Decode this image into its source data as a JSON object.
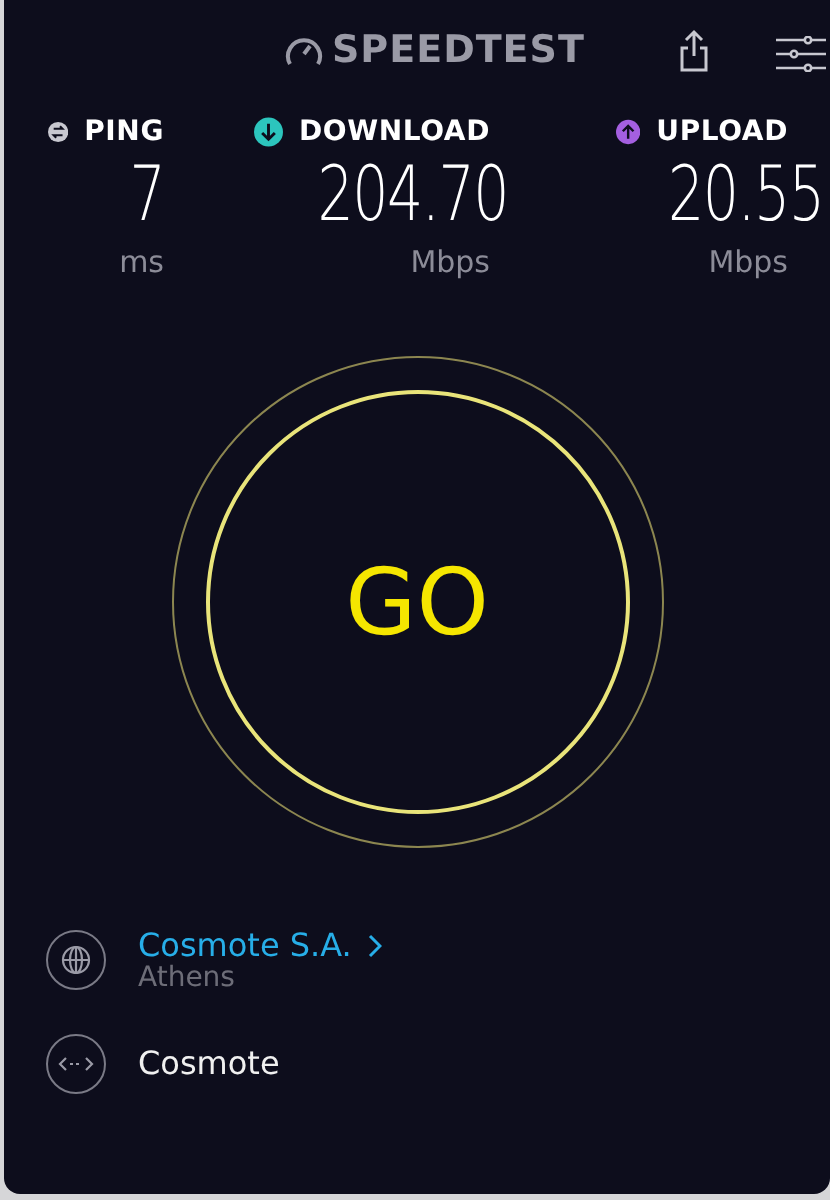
{
  "header": {
    "logo": "SPEEDTEST"
  },
  "metrics": [
    {
      "kind": "ping",
      "label": "PING",
      "value": "7",
      "unit": "ms",
      "color": "#c8c8d0"
    },
    {
      "kind": "download",
      "label": "DOWNLOAD",
      "value": "204.70",
      "unit": "Mbps",
      "color": "#2cc5bd"
    },
    {
      "kind": "upload",
      "label": "UPLOAD",
      "value": "20.55",
      "unit": "Mbps",
      "color": "#a45fe0"
    }
  ],
  "go_button": {
    "label": "GO"
  },
  "provider": {
    "name": "Cosmote S.A.",
    "location": "Athens"
  },
  "server": {
    "name": "Cosmote"
  }
}
